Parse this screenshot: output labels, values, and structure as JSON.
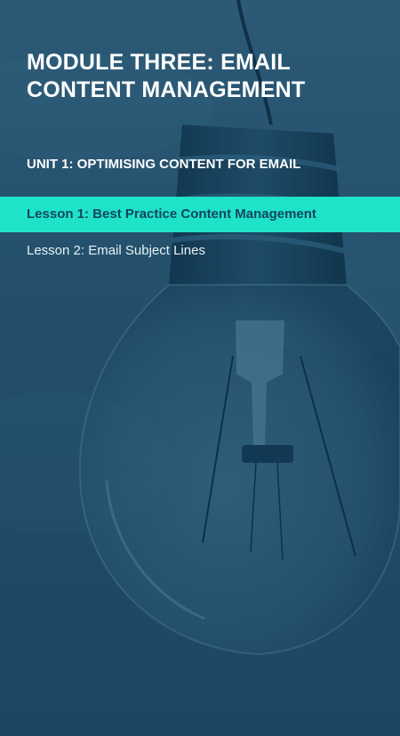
{
  "module": {
    "title": "MODULE THREE: EMAIL CONTENT MANAGEMENT"
  },
  "unit": {
    "title": "UNIT 1: OPTIMISING CONTENT FOR EMAIL"
  },
  "lessons": [
    {
      "label": "Lesson 1: Best Practice Content Management",
      "active": true
    },
    {
      "label": "Lesson 2: Email Subject Lines",
      "active": false
    }
  ],
  "colors": {
    "background": "#234f6b",
    "accent": "#1fe3c9",
    "active_text": "#13455f",
    "text": "#ffffff"
  },
  "background_image": "lightbulb-photo"
}
